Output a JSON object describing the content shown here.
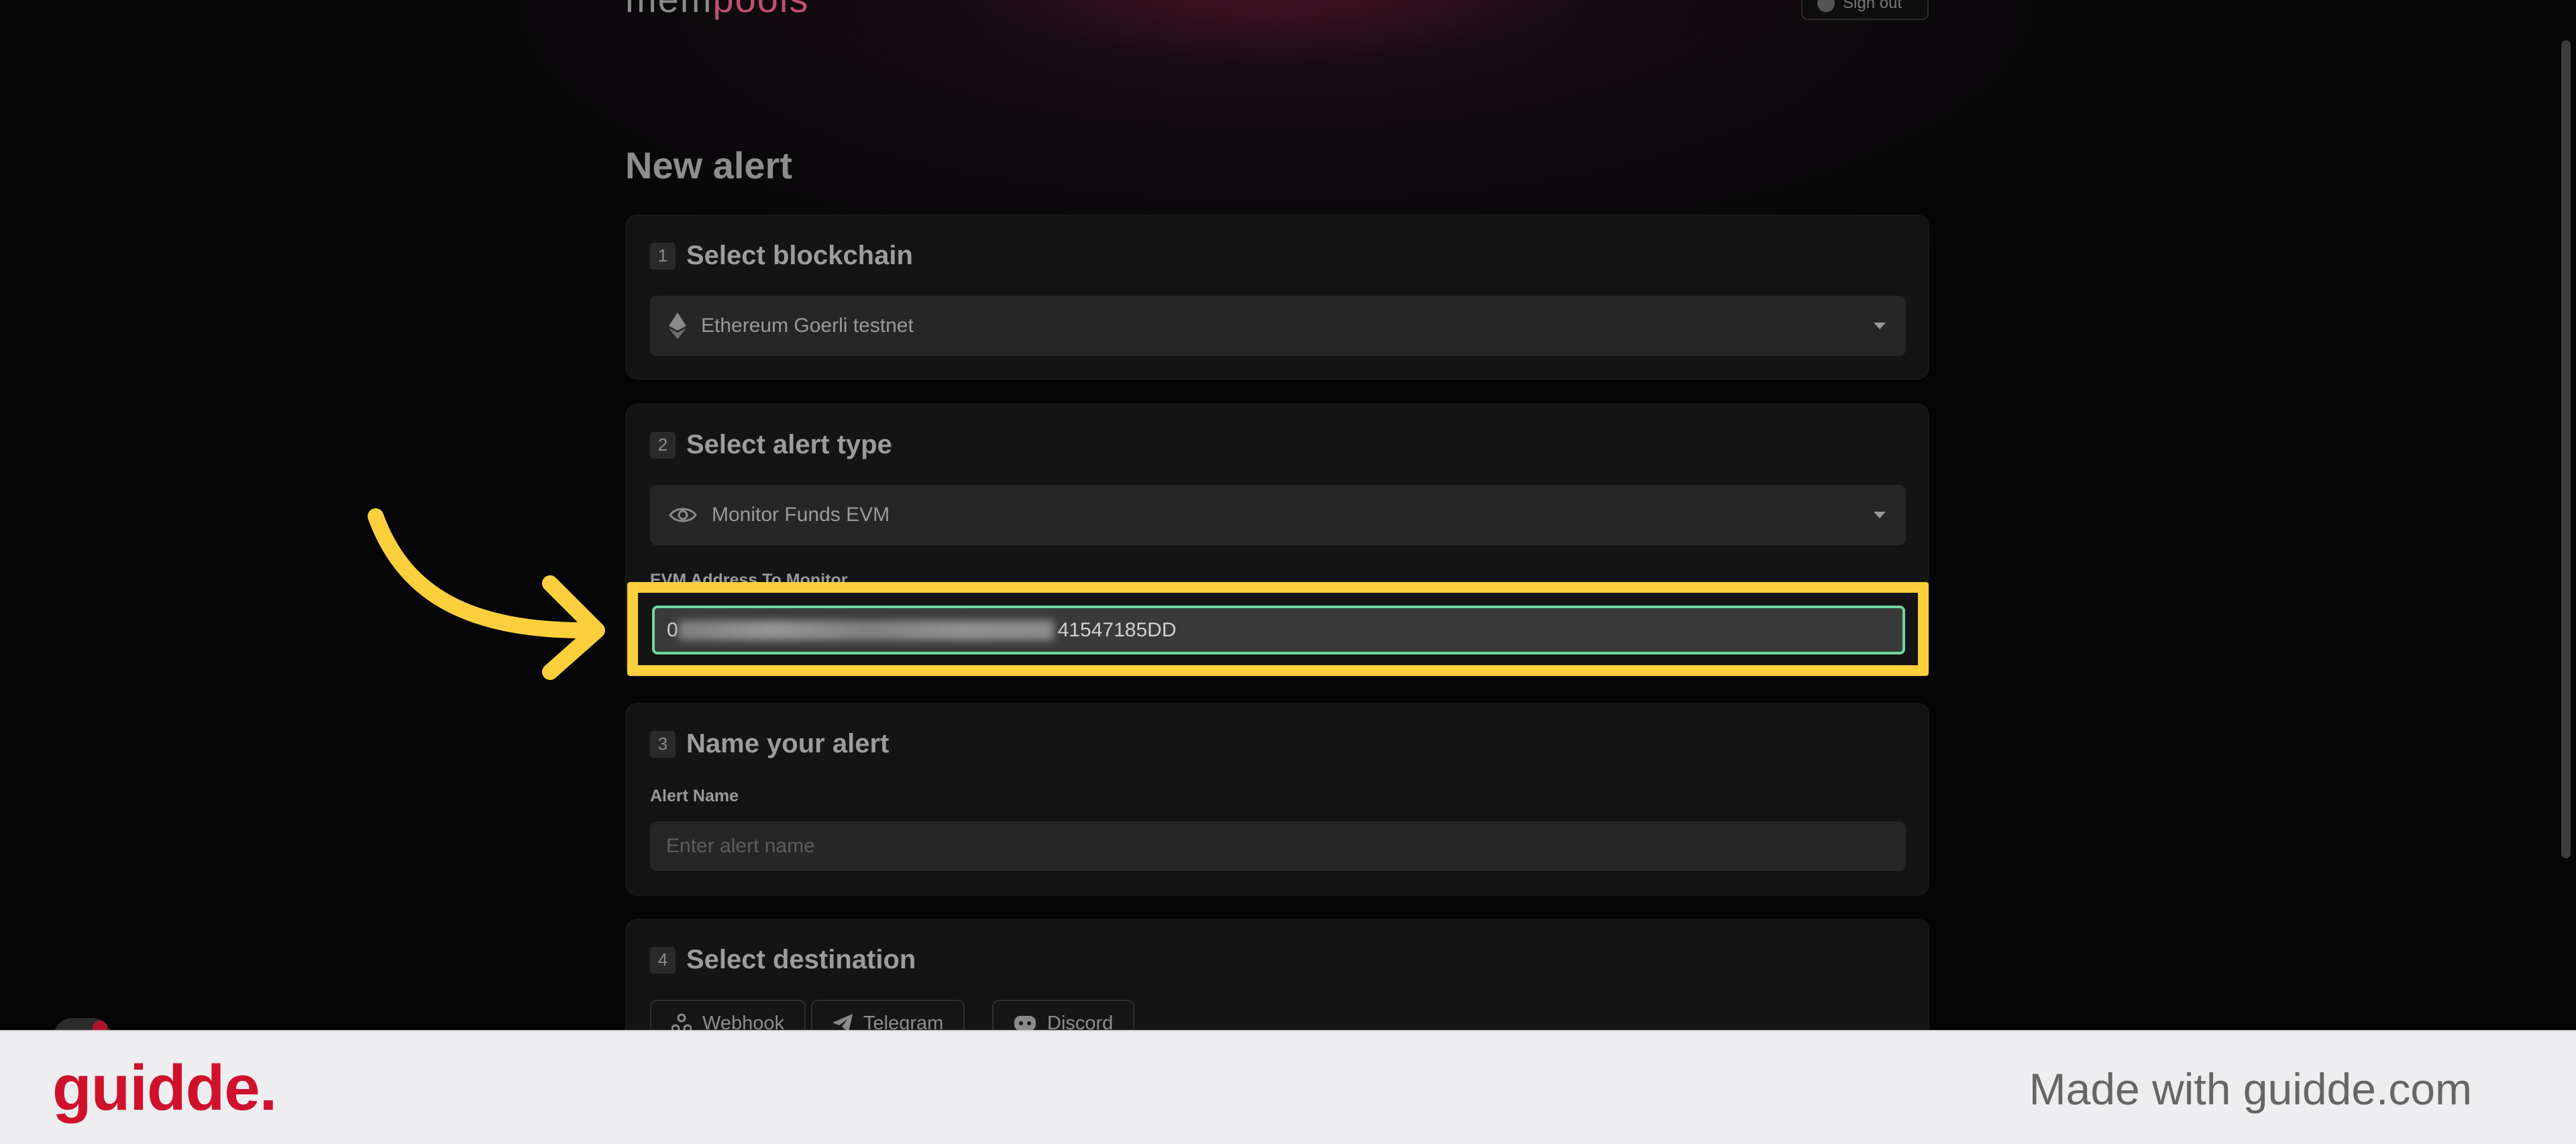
{
  "app": {
    "logo_text_a": "mem",
    "logo_text_b": "pools",
    "signout_label": "Sign out"
  },
  "page": {
    "title": "New alert"
  },
  "steps": [
    {
      "num": "1",
      "title": "Select blockchain",
      "select_value": "Ethereum Goerli testnet",
      "select_icon": "ethereum-icon"
    },
    {
      "num": "2",
      "title": "Select alert type",
      "select_value": "Monitor Funds EVM",
      "select_icon": "eye-icon",
      "field_label": "EVM Address To Monitor",
      "field_value_visible": "41547185DD",
      "field_value_prefix": "0"
    },
    {
      "num": "3",
      "title": "Name your alert",
      "field_label": "Alert Name",
      "field_placeholder": "Enter alert name"
    },
    {
      "num": "4",
      "title": "Select destination",
      "destinations": [
        {
          "label": "Webhook",
          "icon": "webhook-icon"
        },
        {
          "label": "Telegram",
          "icon": "telegram-icon"
        },
        {
          "label": "Discord",
          "icon": "discord-icon"
        }
      ]
    }
  ],
  "footer": {
    "brand": "guidde.",
    "made_with": "Made with guidde.com"
  },
  "colors": {
    "highlight": "#fcd03c",
    "input_focus_border": "#6fd7a3",
    "brand_red": "#d0112b"
  }
}
